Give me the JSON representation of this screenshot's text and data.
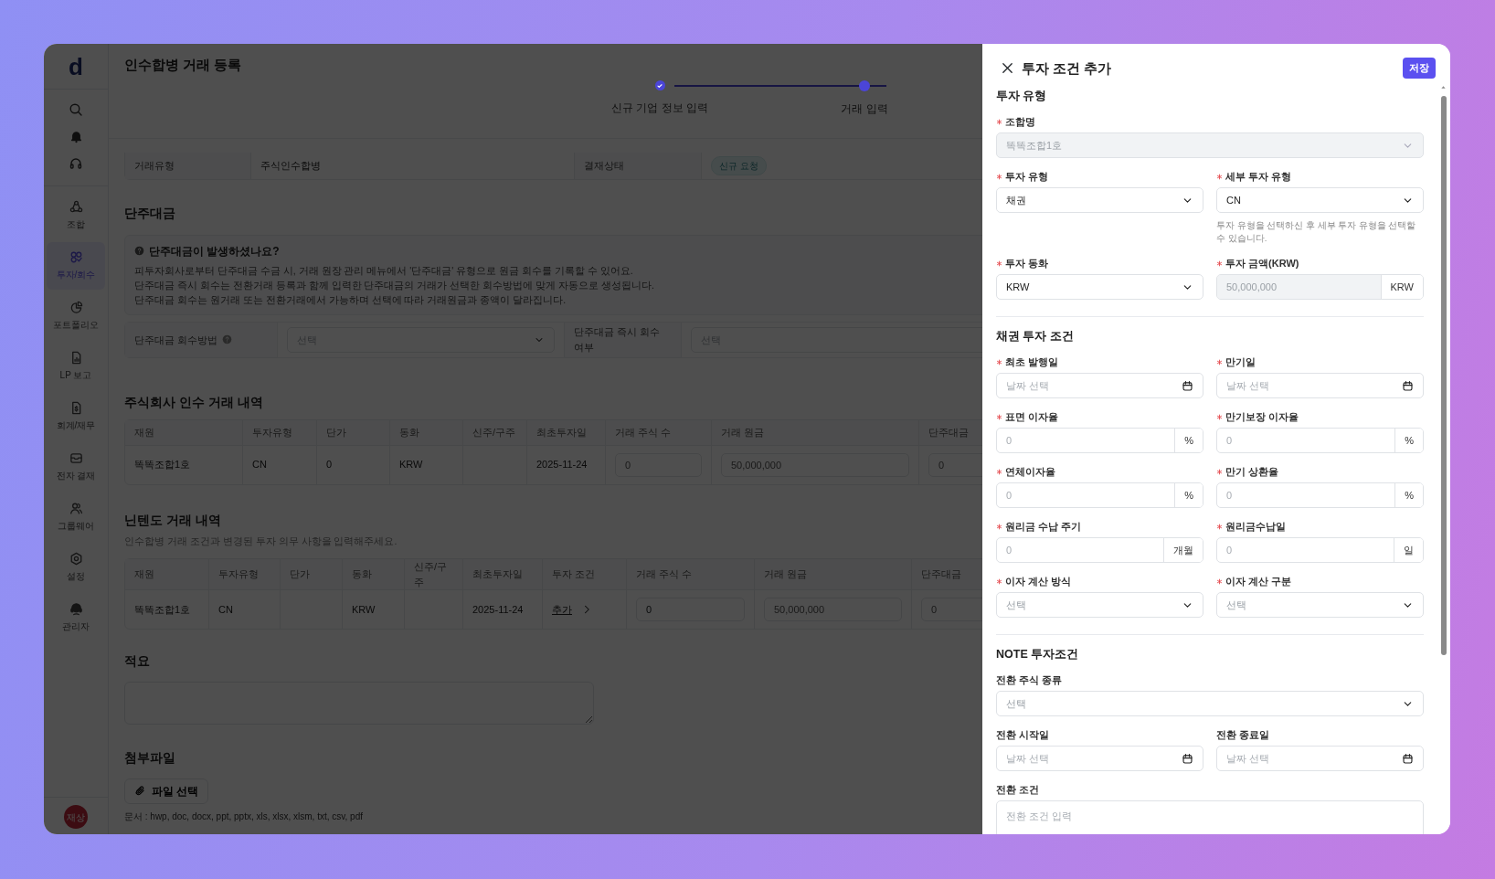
{
  "sidebar": {
    "logo": "d",
    "items": [
      {
        "label": "조합",
        "selected": false
      },
      {
        "label": "투자/회수",
        "selected": true
      },
      {
        "label": "포트폴리오",
        "selected": false
      },
      {
        "label": "LP 보고",
        "selected": false
      },
      {
        "label": "회계/재무",
        "selected": false
      },
      {
        "label": "전자 결재",
        "selected": false
      },
      {
        "label": "그룹웨어",
        "selected": false
      },
      {
        "label": "설정",
        "selected": false
      },
      {
        "label": "관리자",
        "selected": false
      }
    ],
    "avatar": "재상"
  },
  "page": {
    "title": "인수합병 거래 등록",
    "steps": [
      {
        "label": "신규 기업 정보 입력",
        "completed": true
      },
      {
        "label": "거래 입력",
        "completed": false
      }
    ],
    "summary_row": [
      {
        "kind": "label",
        "text": "거래유형"
      },
      {
        "kind": "value",
        "text": "주식인수합병"
      },
      {
        "kind": "label",
        "text": "결재상태"
      },
      {
        "kind": "badge",
        "text": "신규 요청"
      }
    ],
    "fractional": {
      "title": "단주대금",
      "info_title": "단주대금이 발생하셨나요?",
      "info_lines": [
        "피투자회사로부터 단주대금 수금 시, 거래 원장 관리 메뉴에서 '단주대금' 유형으로 원금 회수를 기록할 수 있어요.",
        "단주대금 즉시 회수는 전환거래 등록과 함께 입력한 단주대금의 거래가 선택한 회수방법에 맞게 자동으로 생성됩니다.",
        "단주대금 회수는 원거래 또는 전환거래에서 가능하며 선택에 따라 거래원금과 종액이 달라집니다."
      ],
      "fields": [
        {
          "label": "단주대금 회수방법",
          "help": true,
          "placeholder": "선택"
        },
        {
          "label": "단주대금 즉시 회수 여부",
          "help": false,
          "placeholder": "선택"
        }
      ]
    },
    "acquisition": {
      "title": "주식회사 인수 거래 내역",
      "columns": [
        "재원",
        "투자유형",
        "단가",
        "동화",
        "신주/구주",
        "최초투자일",
        "거래 주식 수",
        "거래 원금",
        "단주대금"
      ],
      "rows": [
        {
          "cells": [
            {
              "kind": "text",
              "text": "똑똑조합1호"
            },
            {
              "kind": "text",
              "text": "CN"
            },
            {
              "kind": "text",
              "text": "0"
            },
            {
              "kind": "text",
              "text": "KRW"
            },
            {
              "kind": "empty"
            },
            {
              "kind": "text",
              "text": "2025-11-24"
            },
            {
              "kind": "input",
              "placeholder": "0"
            },
            {
              "kind": "input",
              "placeholder": "50,000,000"
            },
            {
              "kind": "input",
              "placeholder": "0"
            }
          ]
        }
      ]
    },
    "nintendo": {
      "title": "닌텐도 거래 내역",
      "subtitle": "인수합병 거래 조건과 변경된 투자 의무 사항을 입력해주세요.",
      "columns": [
        "재원",
        "투자유형",
        "단가",
        "동화",
        "신주/구주",
        "최초투자일",
        "투자 조건",
        "거래 주식 수",
        "거래 원금",
        "단주대금"
      ],
      "rows": [
        {
          "cells": [
            {
              "kind": "text",
              "text": "똑똑조합1호"
            },
            {
              "kind": "text",
              "text": "CN"
            },
            {
              "kind": "empty"
            },
            {
              "kind": "text",
              "text": "KRW"
            },
            {
              "kind": "empty"
            },
            {
              "kind": "text",
              "text": "2025-11-24"
            },
            {
              "kind": "link",
              "text": "추가"
            },
            {
              "kind": "input",
              "value": "0"
            },
            {
              "kind": "input",
              "placeholder": "50,000,000"
            },
            {
              "kind": "input",
              "placeholder": "0"
            }
          ]
        }
      ]
    },
    "memo": {
      "title": "적요"
    },
    "attachments": {
      "title": "첨부파일",
      "button": "파일 선택",
      "note": "문서 : hwp, doc, docx, ppt, pptx, xls, xlsx, xlsm, txt, csv, pdf"
    }
  },
  "drawer": {
    "title": "투자 조건 추가",
    "save": "저장",
    "sections": [
      {
        "title": "투자 유형",
        "rows": [
          [
            {
              "kind": "select",
              "label": "조합명",
              "required": true,
              "value": "똑똑조합1호",
              "disabled": true
            }
          ],
          [
            {
              "kind": "select",
              "label": "투자 유형",
              "required": true,
              "value": "채권"
            },
            {
              "kind": "select",
              "label": "세부 투자 유형",
              "required": true,
              "value": "CN",
              "help": "투자 유형을 선택하신 후 세부 투자 유형을 선택할 수 있습니다."
            }
          ],
          [
            {
              "kind": "select",
              "label": "투자 동화",
              "required": true,
              "value": "KRW"
            },
            {
              "kind": "addon",
              "label": "투자 금액(KRW)",
              "required": true,
              "value": "50,000,000",
              "disabled": true,
              "addon": "KRW"
            }
          ]
        ]
      },
      {
        "title": "채권 투자 조건",
        "rows": [
          [
            {
              "kind": "date",
              "label": "최초 발행일",
              "required": true,
              "placeholder": "날짜 선택"
            },
            {
              "kind": "date",
              "label": "만기일",
              "required": true,
              "placeholder": "날짜 선택"
            }
          ],
          [
            {
              "kind": "addon",
              "label": "표면 이자율",
              "required": true,
              "placeholder": "0",
              "addon": "%"
            },
            {
              "kind": "addon",
              "label": "만기보장 이자율",
              "required": true,
              "placeholder": "0",
              "addon": "%"
            }
          ],
          [
            {
              "kind": "addon",
              "label": "연체이자율",
              "required": true,
              "placeholder": "0",
              "addon": "%"
            },
            {
              "kind": "addon",
              "label": "만기 상환율",
              "required": true,
              "placeholder": "0",
              "addon": "%"
            }
          ],
          [
            {
              "kind": "addon",
              "label": "원리금 수납 주기",
              "required": true,
              "placeholder": "0",
              "addon": "개월"
            },
            {
              "kind": "addon",
              "label": "원리금수납일",
              "required": true,
              "placeholder": "0",
              "addon": "일"
            }
          ],
          [
            {
              "kind": "select",
              "label": "이자 계산 방식",
              "required": true,
              "placeholder": "선택"
            },
            {
              "kind": "select",
              "label": "이자 계산 구분",
              "required": true,
              "placeholder": "선택"
            }
          ]
        ]
      },
      {
        "title": "NOTE 투자조건",
        "rows": [
          [
            {
              "kind": "select",
              "label": "전환 주식 종류",
              "required": false,
              "placeholder": "선택"
            }
          ],
          [
            {
              "kind": "date",
              "label": "전환 시작일",
              "required": false,
              "placeholder": "날짜 선택"
            },
            {
              "kind": "date",
              "label": "전환 종료일",
              "required": false,
              "placeholder": "날짜 선택"
            }
          ],
          [
            {
              "kind": "textarea",
              "label": "전환 조건",
              "required": false,
              "placeholder": "전환 조건 입력"
            }
          ]
        ]
      }
    ]
  }
}
